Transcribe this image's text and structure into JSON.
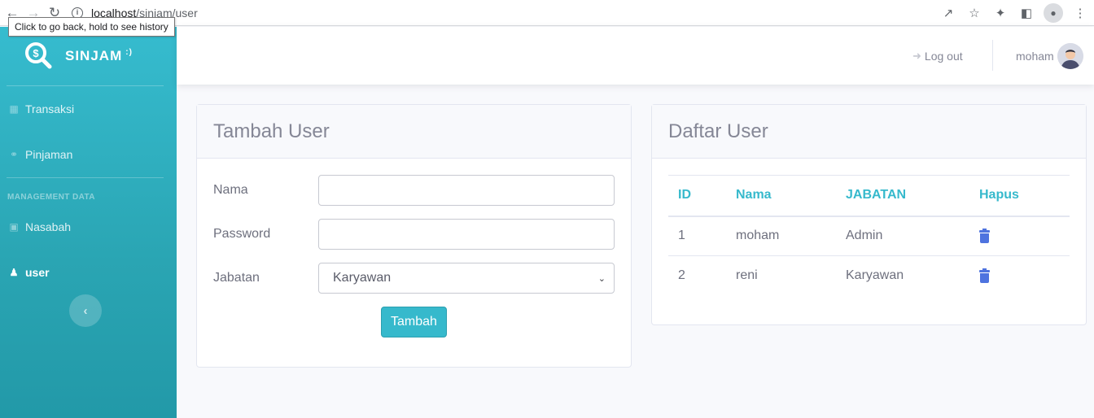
{
  "browser": {
    "url_host": "localhost",
    "url_path": "/sinjam/user",
    "tooltip": "Click to go back, hold to see history"
  },
  "sidebar": {
    "brand": "SINJAM",
    "brand_sup": ":)",
    "items": [
      {
        "label": "Transaksi",
        "icon": "building-icon"
      },
      {
        "label": "Pinjaman",
        "icon": "hand-holding-icon"
      }
    ],
    "heading": "MANAGEMENT DATA",
    "items2": [
      {
        "label": "Nasabah",
        "icon": "address-book-icon"
      },
      {
        "label": "user",
        "icon": "user-icon"
      }
    ],
    "toggle_icon": "chevron-left-icon"
  },
  "topbar": {
    "logout": "Log out",
    "username": "moham"
  },
  "form_card": {
    "title": "Tambah User",
    "name_label": "Nama",
    "name_value": "",
    "password_label": "Password",
    "password_value": "",
    "role_label": "Jabatan",
    "role_value": "Karyawan",
    "submit": "Tambah"
  },
  "list_card": {
    "title": "Daftar User",
    "columns": [
      "ID",
      "Nama",
      "JABATAN",
      "Hapus"
    ],
    "rows": [
      {
        "id": "1",
        "name": "moham",
        "role": "Admin"
      },
      {
        "id": "2",
        "name": "reni",
        "role": "Karyawan"
      }
    ]
  },
  "colors": {
    "accent": "#36b9cc",
    "delete": "#4e73df"
  }
}
